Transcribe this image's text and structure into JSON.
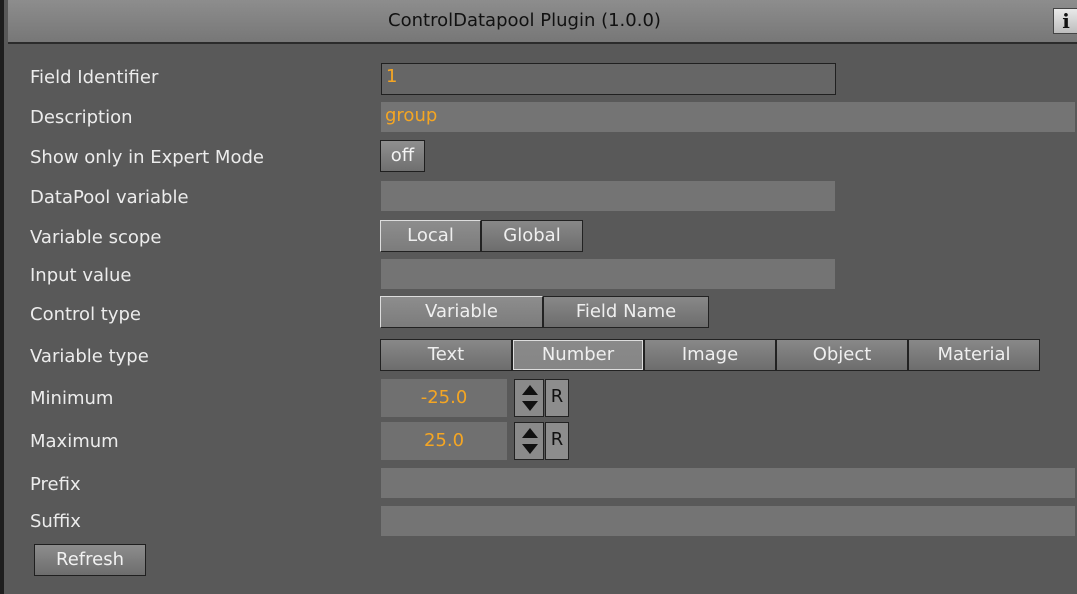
{
  "window": {
    "title": "ControlDatapool Plugin (1.0.0)",
    "info_label": "i"
  },
  "fields": {
    "field_identifier": {
      "label": "Field Identifier",
      "value": "1"
    },
    "description": {
      "label": "Description",
      "value": "group"
    },
    "show_expert": {
      "label": "Show only in Expert Mode",
      "value": "off"
    },
    "datapool_variable": {
      "label": "DataPool variable",
      "value": ""
    },
    "variable_scope": {
      "label": "Variable scope",
      "options": [
        "Local",
        "Global"
      ],
      "selected": "Local"
    },
    "input_value": {
      "label": "Input value",
      "value": ""
    },
    "control_type": {
      "label": "Control type",
      "options": [
        "Variable",
        "Field Name"
      ],
      "selected": "Variable"
    },
    "variable_type": {
      "label": "Variable type",
      "options": [
        "Text",
        "Number",
        "Image",
        "Object",
        "Material"
      ],
      "selected": "Number"
    },
    "minimum": {
      "label": "Minimum",
      "value": "-25.0",
      "reset_label": "R"
    },
    "maximum": {
      "label": "Maximum",
      "value": "25.0",
      "reset_label": "R"
    },
    "prefix": {
      "label": "Prefix",
      "value": ""
    },
    "suffix": {
      "label": "Suffix",
      "value": ""
    }
  },
  "actions": {
    "refresh_label": "Refresh"
  }
}
